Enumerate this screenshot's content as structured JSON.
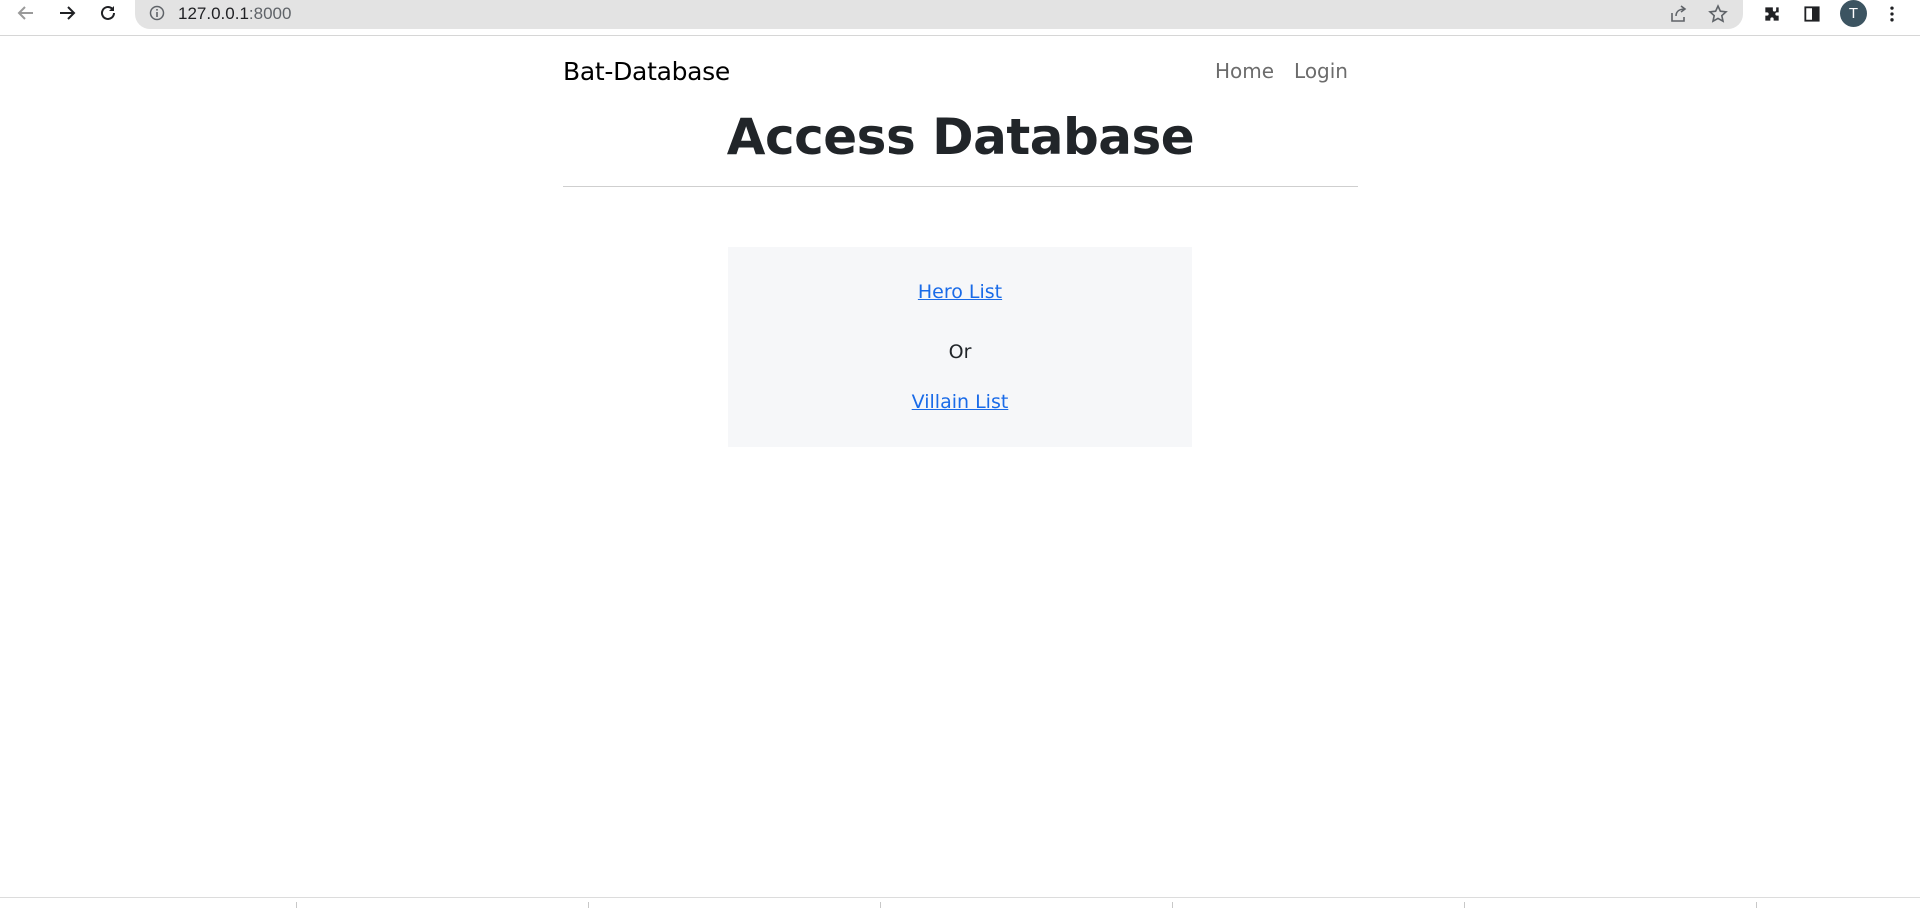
{
  "browser": {
    "url_host": "127.0.0.1",
    "url_port": ":8000",
    "avatar_letter": "T"
  },
  "navbar": {
    "brand": "Bat-Database",
    "links": [
      "Home",
      "Login"
    ]
  },
  "main": {
    "title": "Access Database",
    "hero_link": "Hero List",
    "or_text": "Or",
    "villain_link": "Villain List"
  },
  "colors": {
    "link": "#1a6be8",
    "card_bg": "#f6f7f9",
    "title": "#212529"
  }
}
